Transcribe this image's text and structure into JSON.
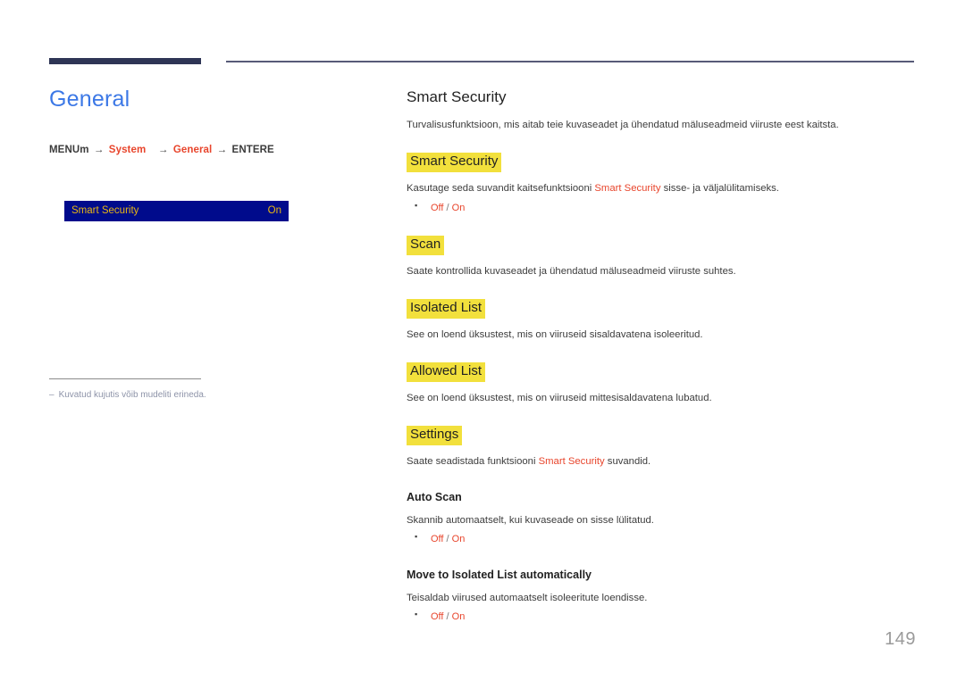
{
  "theme": {
    "accent_blue": "#3c78e6",
    "accent_red": "#e8452c",
    "highlight_yellow": "#f2e03c",
    "osd_background": "#000b8c",
    "osd_text": "#e8b713",
    "rule_navy": "#2e3555",
    "page_number_gray": "#9a9a9a"
  },
  "left": {
    "page_title": "General",
    "breadcrumb": {
      "start": "MENUm",
      "arrow": "→",
      "step1": "System",
      "step2": "General",
      "end": "ENTERE"
    },
    "osd": {
      "label": "Smart Security",
      "value": "On"
    },
    "footnote": {
      "dash": "–",
      "text": "Kuvatud kujutis võib mudeliti erineda."
    }
  },
  "right": {
    "section_title": "Smart Security",
    "intro": "Turvalisusfunktsioon, mis aitab teie kuvaseadet ja ühendatud mäluseadmeid viiruste eest kaitsta.",
    "blocks": [
      {
        "heading": "Smart Security",
        "heading_style": "highlight",
        "desc_pre": "Kasutage seda suvandit kaitsefunktsiooni ",
        "desc_accent": "Smart Security",
        "desc_post": " sisse- ja väljalülitamiseks.",
        "options": [
          {
            "off": "Off",
            "sep": "/",
            "on": "On"
          }
        ]
      },
      {
        "heading": "Scan",
        "heading_style": "highlight",
        "desc_pre": "Saate kontrollida kuvaseadet ja ühendatud mäluseadmeid viiruste suhtes.",
        "desc_accent": "",
        "desc_post": "",
        "options": []
      },
      {
        "heading": "Isolated List",
        "heading_style": "highlight",
        "desc_pre": "See on loend üksustest, mis on viiruseid sisaldavatena isoleeritud.",
        "desc_accent": "",
        "desc_post": "",
        "options": []
      },
      {
        "heading": "Allowed List",
        "heading_style": "highlight",
        "desc_pre": "See on loend üksustest, mis on viiruseid mittesisaldavatena lubatud.",
        "desc_accent": "",
        "desc_post": "",
        "options": []
      },
      {
        "heading": "Settings",
        "heading_style": "highlight",
        "desc_pre": "Saate seadistada funktsiooni ",
        "desc_accent": "Smart Security",
        "desc_post": " suvandid.",
        "options": []
      },
      {
        "heading": "Auto Scan",
        "heading_style": "plain",
        "desc_pre": "Skannib automaatselt, kui kuvaseade on sisse lülitatud.",
        "desc_accent": "",
        "desc_post": "",
        "options": [
          {
            "off": "Off",
            "sep": "/",
            "on": "On"
          }
        ]
      },
      {
        "heading": "Move to Isolated List automatically",
        "heading_style": "plain",
        "desc_pre": "Teisaldab viirused automaatselt isoleeritute loendisse.",
        "desc_accent": "",
        "desc_post": "",
        "options": [
          {
            "off": "Off",
            "sep": "/",
            "on": "On"
          }
        ]
      }
    ]
  },
  "page_number": "149"
}
